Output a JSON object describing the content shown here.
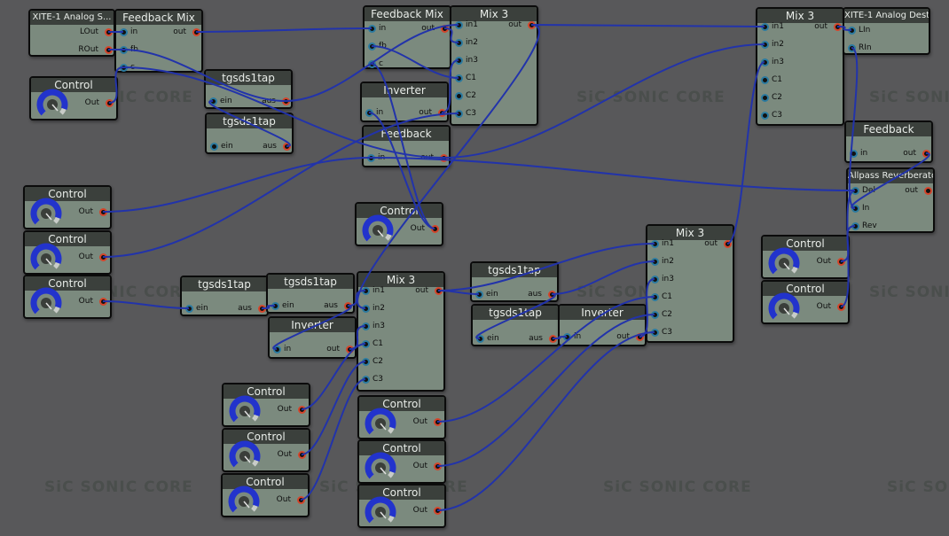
{
  "watermark": "SiC SONIC CORE",
  "modules": {
    "xite_src": {
      "title": "XITE-1 Analog S...",
      "out1": "LOut",
      "out2": "ROut"
    },
    "fbmix_top": {
      "title": "Feedback Mix",
      "in1": "in",
      "in2": "fb",
      "in3": "c",
      "out": "out"
    },
    "fbmix_mid": {
      "title": "Feedback Mix",
      "in1": "in",
      "in2": "fb",
      "in3": "c",
      "out": "out"
    },
    "tap_a": {
      "title": "tgsds1tap",
      "in": "ein",
      "out": "aus"
    },
    "tap_b": {
      "title": "tgsds1tap",
      "in": "ein",
      "out": "aus"
    },
    "tap_c": {
      "title": "tgsds1tap",
      "in": "ein",
      "out": "aus"
    },
    "tap_d": {
      "title": "tgsds1tap",
      "in": "ein",
      "out": "aus"
    },
    "tap_e": {
      "title": "tgsds1tap",
      "in": "ein",
      "out": "aus"
    },
    "tap_f": {
      "title": "tgsds1tap",
      "in": "ein",
      "out": "aus"
    },
    "mix3_a": {
      "title": "Mix 3",
      "ports": [
        "in1",
        "in2",
        "in3",
        "C1",
        "C2",
        "C3"
      ],
      "out": "out"
    },
    "mix3_b": {
      "title": "Mix 3",
      "ports": [
        "in1",
        "in2",
        "in3",
        "C1",
        "C2",
        "C3"
      ],
      "out": "out"
    },
    "mix3_c": {
      "title": "Mix 3",
      "ports": [
        "in1",
        "in2",
        "in3",
        "C1",
        "C2",
        "C3"
      ],
      "out": "out"
    },
    "mix3_d": {
      "title": "Mix 3",
      "ports": [
        "in1",
        "in2",
        "in3",
        "C1",
        "C2",
        "C3"
      ],
      "out": "out"
    },
    "inverter_a": {
      "title": "Inverter",
      "in": "in",
      "out": "out"
    },
    "inverter_b": {
      "title": "Inverter",
      "in": "in",
      "out": "out"
    },
    "inverter_c": {
      "title": "Inverter",
      "in": "in",
      "out": "out"
    },
    "feedback_a": {
      "title": "Feedback",
      "in": "in",
      "out": "out"
    },
    "feedback_b": {
      "title": "Feedback",
      "in": "in",
      "out": "out"
    },
    "xite_dest": {
      "title": "XITE-1 Analog Dest",
      "in1": "LIn",
      "in2": "RIn"
    },
    "allpass": {
      "title": "Allpass Reverberator",
      "in1": "Del",
      "in2": "In",
      "in3": "Rev",
      "out": "out"
    },
    "control_label": "Control",
    "control_out": "Out"
  },
  "colors": {
    "background": "#58585a",
    "module": "#7b8a7e",
    "title_bar": "#3b403c",
    "wire": "#2233aa",
    "knob": "#2233cc"
  }
}
